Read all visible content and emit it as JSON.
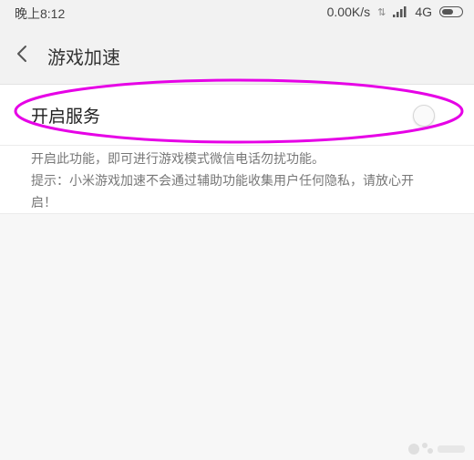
{
  "status_bar": {
    "time": "晚上8:12",
    "network_speed": "0.00K/s",
    "network_type": "4G",
    "icons": [
      "data-arrows-icon",
      "signal-icon",
      "battery-icon"
    ]
  },
  "header": {
    "title": "游戏加速",
    "back_icon": "chevron-left-icon"
  },
  "service_toggle": {
    "label": "开启服务",
    "enabled": false
  },
  "description": {
    "line1": "开启此功能，即可进行游戏模式微信电话勿扰功能。",
    "line2": "提示：小米游戏加速不会通过辅助功能收集用户任何隐私，请放心开",
    "line3": "启！"
  },
  "colors": {
    "highlight": "#e600e6",
    "background": "#f7f7f7",
    "card": "#ffffff"
  }
}
